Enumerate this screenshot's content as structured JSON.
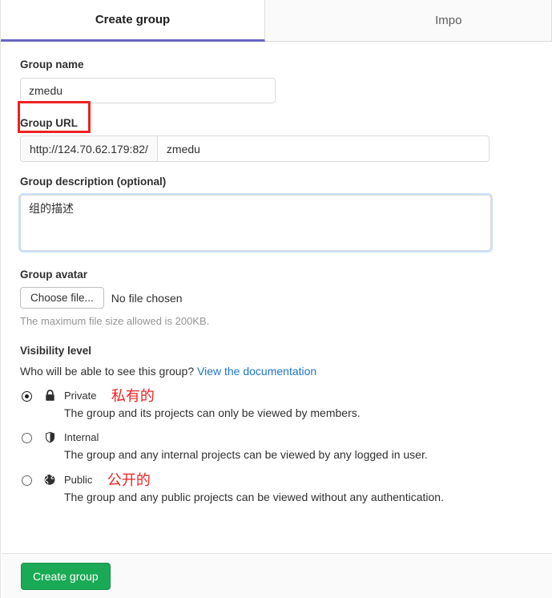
{
  "tabs": [
    {
      "label": "Create group",
      "active": true
    },
    {
      "label": "Impo",
      "active": false
    }
  ],
  "form": {
    "group_name": {
      "label": "Group name",
      "value": "zmedu",
      "placeholder": ""
    },
    "group_url": {
      "label": "Group URL",
      "prefix": "http://124.70.62.179:82/",
      "value": "zmedu",
      "placeholder": ""
    },
    "group_description": {
      "label": "Group description (optional)",
      "value": "组的描述",
      "placeholder": ""
    },
    "group_avatar": {
      "label": "Group avatar",
      "choose_button": "Choose file...",
      "file_status": "No file chosen",
      "help": "The maximum file size allowed is 200KB."
    }
  },
  "visibility": {
    "title": "Visibility level",
    "question": "Who will be able to see this group?",
    "doc_link": "View the documentation",
    "options": [
      {
        "name": "Private",
        "icon": "lock-icon",
        "description": "The group and its projects can only be viewed by members.",
        "selected": true,
        "annotation": "私有的"
      },
      {
        "name": "Internal",
        "icon": "shield-icon",
        "description": "The group and any internal projects can be viewed by any logged in user.",
        "selected": false,
        "annotation": ""
      },
      {
        "name": "Public",
        "icon": "globe-icon",
        "description": "The group and any public projects can be viewed without any authentication.",
        "selected": false,
        "annotation": "公开的"
      }
    ]
  },
  "footer": {
    "submit_label": "Create group"
  },
  "colors": {
    "accent_tab": "#6666c4",
    "link": "#1f75cb",
    "primary_button": "#1aaa55",
    "annotation": "#ee2222",
    "focus_border": "#80bdff"
  }
}
